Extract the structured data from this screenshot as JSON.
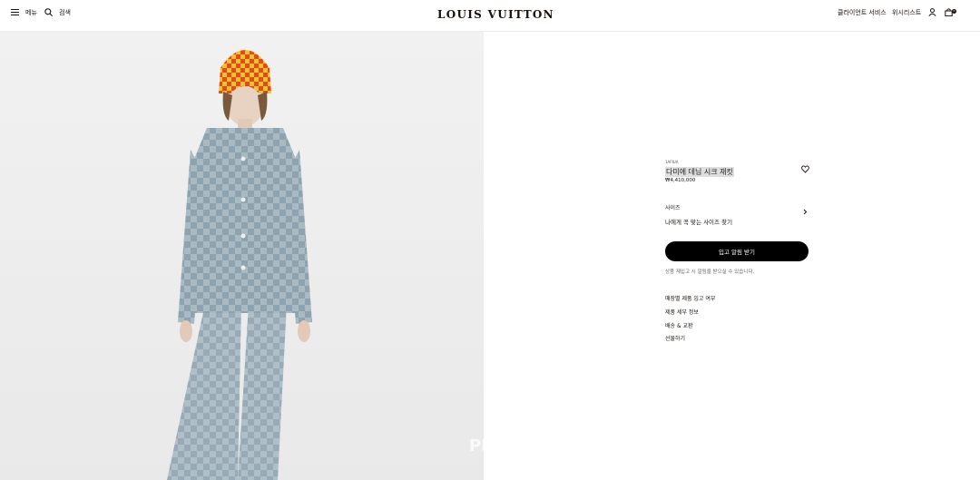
{
  "header": {
    "menu_label": "메뉴",
    "search_label": "검색",
    "brand": "LOUIS VUITTON",
    "client_service_label": "클라이언트 서비스",
    "wishlist_label": "위시리스트",
    "bag_count": "0",
    "icons": {
      "menu": "hamburger-icon",
      "search": "search-icon",
      "account": "user-icon",
      "bag": "shopping-bag-icon"
    }
  },
  "image_panel": {
    "watermark": "PR"
  },
  "product": {
    "sku": "1AFIUA",
    "title": "다미에 데님 시크 재킷",
    "price": "₩4,410,000",
    "wishlist_icon": "heart-icon"
  },
  "size": {
    "label": "사이즈",
    "icon": "chevron-right-icon"
  },
  "fit_link": "나에게 꼭 맞는 사이즈 찾기",
  "notify": {
    "button_label": "입고 알림 받기",
    "note": "상품 재입고 시 알림을 받으실 수 있습니다."
  },
  "accordion": [
    {
      "label": "매장별 제품 입고 여부"
    },
    {
      "label": "제품 세부 정보"
    },
    {
      "label": "배송 & 교환"
    },
    {
      "label": "선물하기"
    }
  ],
  "colors": {
    "text": "#19110b",
    "button_bg": "#000000",
    "panel_bg": "#eeeeee"
  }
}
